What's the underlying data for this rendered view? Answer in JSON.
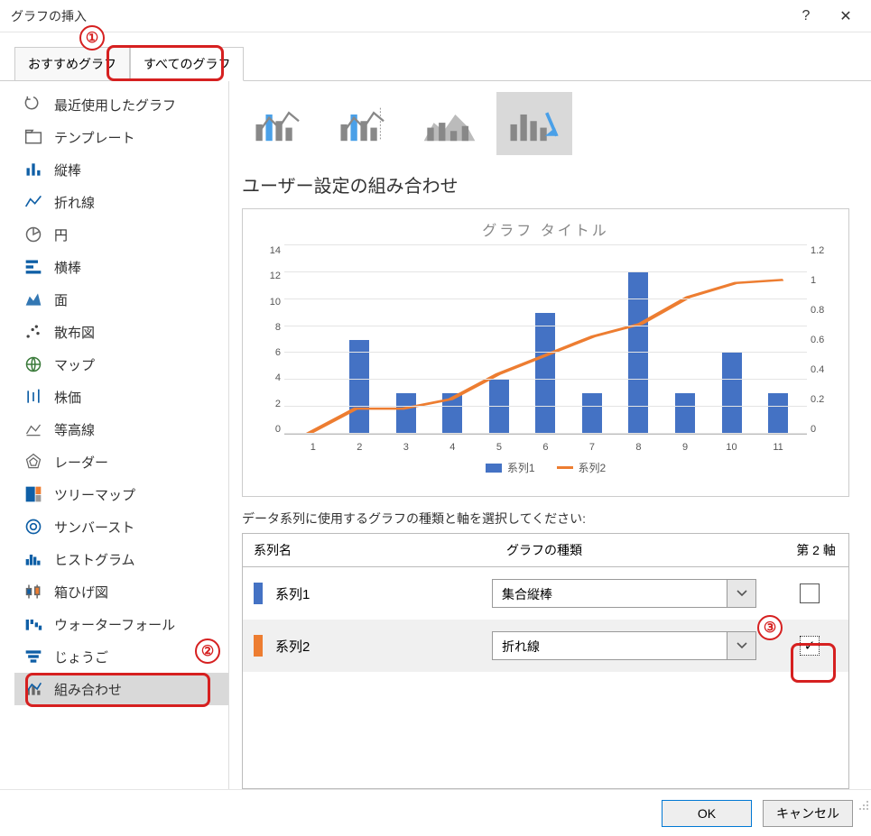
{
  "window": {
    "title": "グラフの挿入",
    "help": "?",
    "close": "✕"
  },
  "tabs": {
    "recommended": "おすすめグラフ",
    "all": "すべてのグラフ"
  },
  "sidebar": {
    "items": [
      {
        "label": "最近使用したグラフ"
      },
      {
        "label": "テンプレート"
      },
      {
        "label": "縦棒"
      },
      {
        "label": "折れ線"
      },
      {
        "label": "円"
      },
      {
        "label": "横棒"
      },
      {
        "label": "面"
      },
      {
        "label": "散布図"
      },
      {
        "label": "マップ"
      },
      {
        "label": "株価"
      },
      {
        "label": "等高線"
      },
      {
        "label": "レーダー"
      },
      {
        "label": "ツリーマップ"
      },
      {
        "label": "サンバースト"
      },
      {
        "label": "ヒストグラム"
      },
      {
        "label": "箱ひげ図"
      },
      {
        "label": "ウォーターフォール"
      },
      {
        "label": "じょうご"
      },
      {
        "label": "組み合わせ"
      }
    ]
  },
  "content": {
    "title": "ユーザー設定の組み合わせ",
    "preview_title": "グラフ タイトル",
    "legend": {
      "s1": "系列1",
      "s2": "系列2"
    },
    "series_instruction": "データ系列に使用するグラフの種類と軸を選択してください:",
    "table_headers": {
      "name": "系列名",
      "type": "グラフの種類",
      "axis": "第 2 軸"
    },
    "series": [
      {
        "name": "系列1",
        "type": "集合縦棒",
        "secondary": false,
        "color": "#4472c4"
      },
      {
        "name": "系列2",
        "type": "折れ線",
        "secondary": true,
        "color": "#ed7d31"
      }
    ]
  },
  "chart_data": {
    "type": "combo",
    "title": "グラフ タイトル",
    "categories": [
      "1",
      "2",
      "3",
      "4",
      "5",
      "6",
      "7",
      "8",
      "9",
      "10",
      "11"
    ],
    "y1_ticks": [
      0,
      2,
      4,
      6,
      8,
      10,
      12,
      14
    ],
    "y2_ticks": [
      0,
      0.2,
      0.4,
      0.6,
      0.8,
      1,
      1.2
    ],
    "ylim_left": [
      0,
      14
    ],
    "ylim_right": [
      0,
      1.2
    ],
    "series": [
      {
        "name": "系列1",
        "type": "bar",
        "axis": "left",
        "color": "#4472c4",
        "values": [
          0,
          7,
          3,
          3,
          4,
          9,
          3,
          12,
          3,
          6,
          3
        ]
      },
      {
        "name": "系列2",
        "type": "line",
        "axis": "right",
        "color": "#ed7d31",
        "values": [
          0.0,
          0.16,
          0.16,
          0.22,
          0.38,
          0.5,
          0.62,
          0.7,
          0.87,
          0.96,
          0.98
        ]
      }
    ]
  },
  "footer": {
    "ok": "OK",
    "cancel": "キャンセル"
  },
  "annotations": {
    "n1": "①",
    "n2": "②",
    "n3": "③"
  }
}
